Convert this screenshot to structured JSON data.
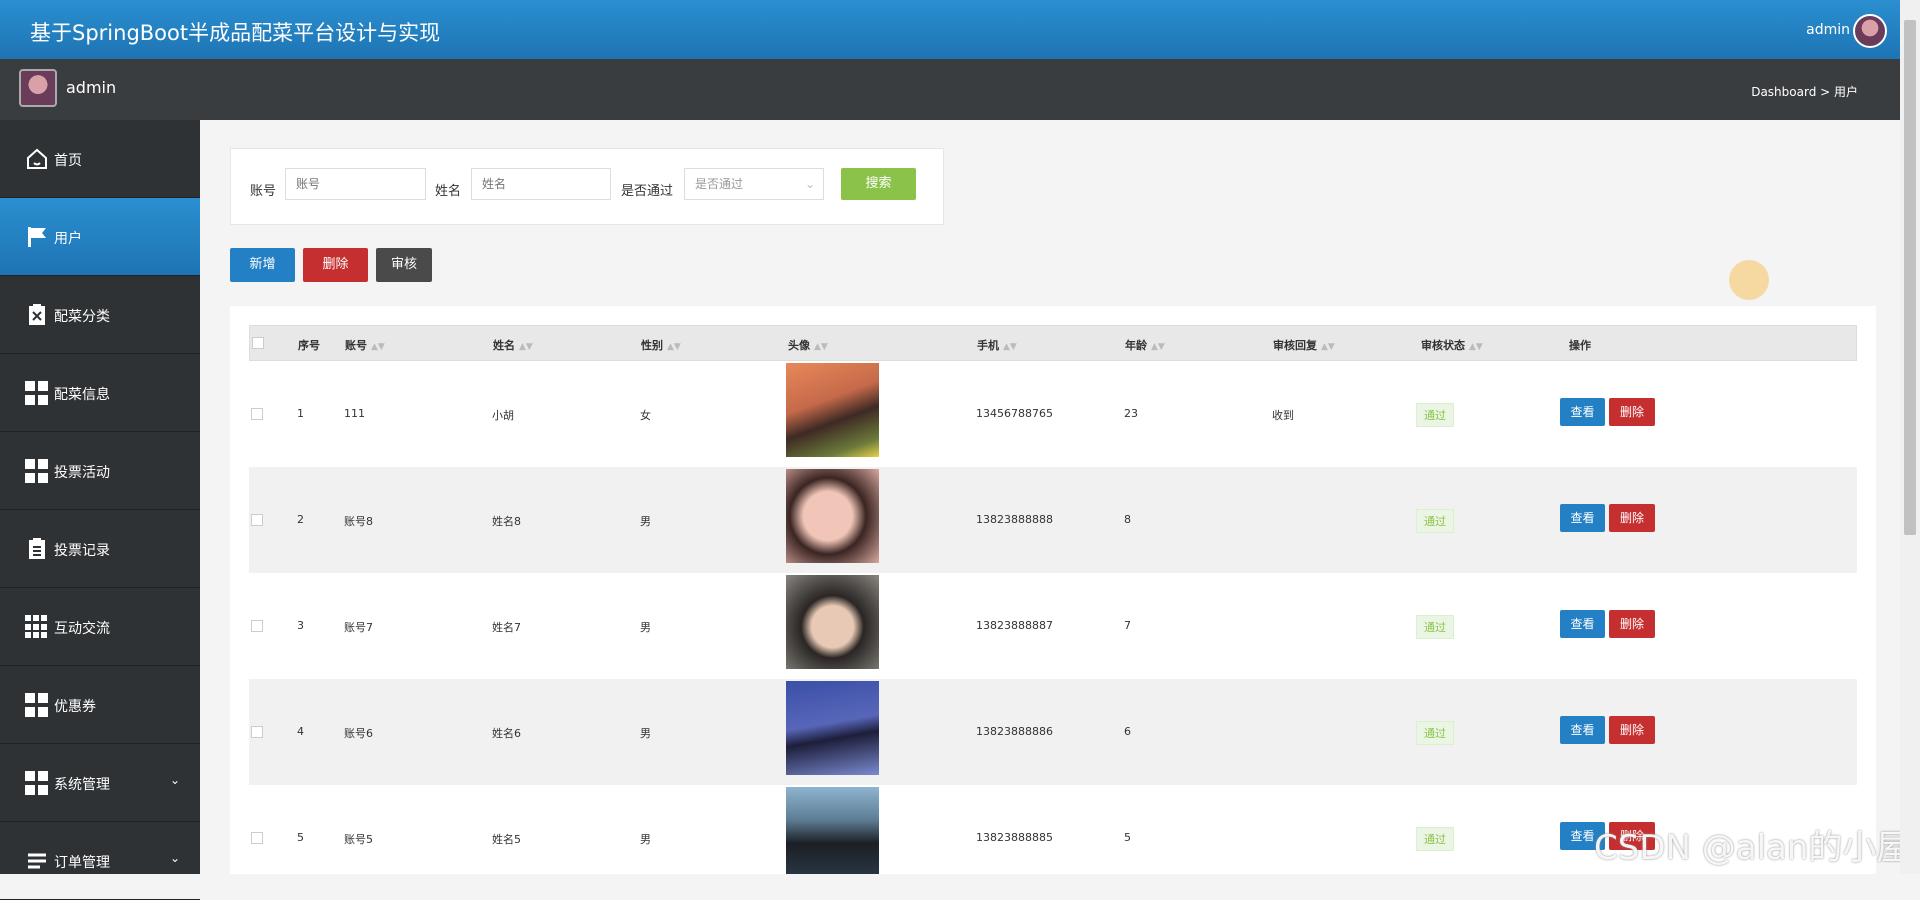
{
  "app": {
    "title": "基于SpringBoot半成品配菜平台设计与实现",
    "user": "admin"
  },
  "subbar": {
    "name": "admin",
    "breadcrumb": "Dashboard > 用户"
  },
  "sidebar": {
    "items": [
      {
        "label": "首页",
        "icon": "home-icon"
      },
      {
        "label": "用户",
        "icon": "flag-icon",
        "active": true
      },
      {
        "label": "配菜分类",
        "icon": "clipboard-x-icon"
      },
      {
        "label": "配菜信息",
        "icon": "grid-icon"
      },
      {
        "label": "投票活动",
        "icon": "grid-icon"
      },
      {
        "label": "投票记录",
        "icon": "clipboard-list-icon"
      },
      {
        "label": "互动交流",
        "icon": "grid9-icon"
      },
      {
        "label": "优惠券",
        "icon": "grid-icon"
      },
      {
        "label": "系统管理",
        "icon": "grid-icon",
        "chevron": "⌄"
      },
      {
        "label": "订单管理",
        "icon": "list-icon",
        "chevron": "⌄"
      }
    ]
  },
  "search": {
    "account_label": "账号",
    "account_placeholder": "账号",
    "name_label": "姓名",
    "name_placeholder": "姓名",
    "passed_label": "是否通过",
    "passed_placeholder": "是否通过",
    "search_button": "搜索"
  },
  "actions": {
    "add": "新增",
    "delete": "删除",
    "audit": "审核"
  },
  "table": {
    "headers": [
      "序号",
      "账号",
      "姓名",
      "性别",
      "头像",
      "手机",
      "年龄",
      "审核回复",
      "审核状态",
      "操作"
    ],
    "rows": [
      {
        "no": "1",
        "account": "111",
        "name": "小胡",
        "gender": "女",
        "phone": "13456788765",
        "age": "23",
        "reply": "收到",
        "status": "通过"
      },
      {
        "no": "2",
        "account": "账号8",
        "name": "姓名8",
        "gender": "男",
        "phone": "13823888888",
        "age": "8",
        "reply": "",
        "status": "通过"
      },
      {
        "no": "3",
        "account": "账号7",
        "name": "姓名7",
        "gender": "男",
        "phone": "13823888887",
        "age": "7",
        "reply": "",
        "status": "通过"
      },
      {
        "no": "4",
        "account": "账号6",
        "name": "姓名6",
        "gender": "男",
        "phone": "13823888886",
        "age": "6",
        "reply": "",
        "status": "通过"
      },
      {
        "no": "5",
        "account": "账号5",
        "name": "姓名5",
        "gender": "男",
        "phone": "13823888885",
        "age": "5",
        "reply": "",
        "status": "通过"
      }
    ],
    "view_button": "查看",
    "delete_button": "删除"
  },
  "watermark": "CSDN @alan的小屋",
  "colors": {
    "primary": "#1e74b4",
    "danger": "#c62f2f",
    "success": "#8bc34a",
    "sidebar": "#2f3234"
  }
}
